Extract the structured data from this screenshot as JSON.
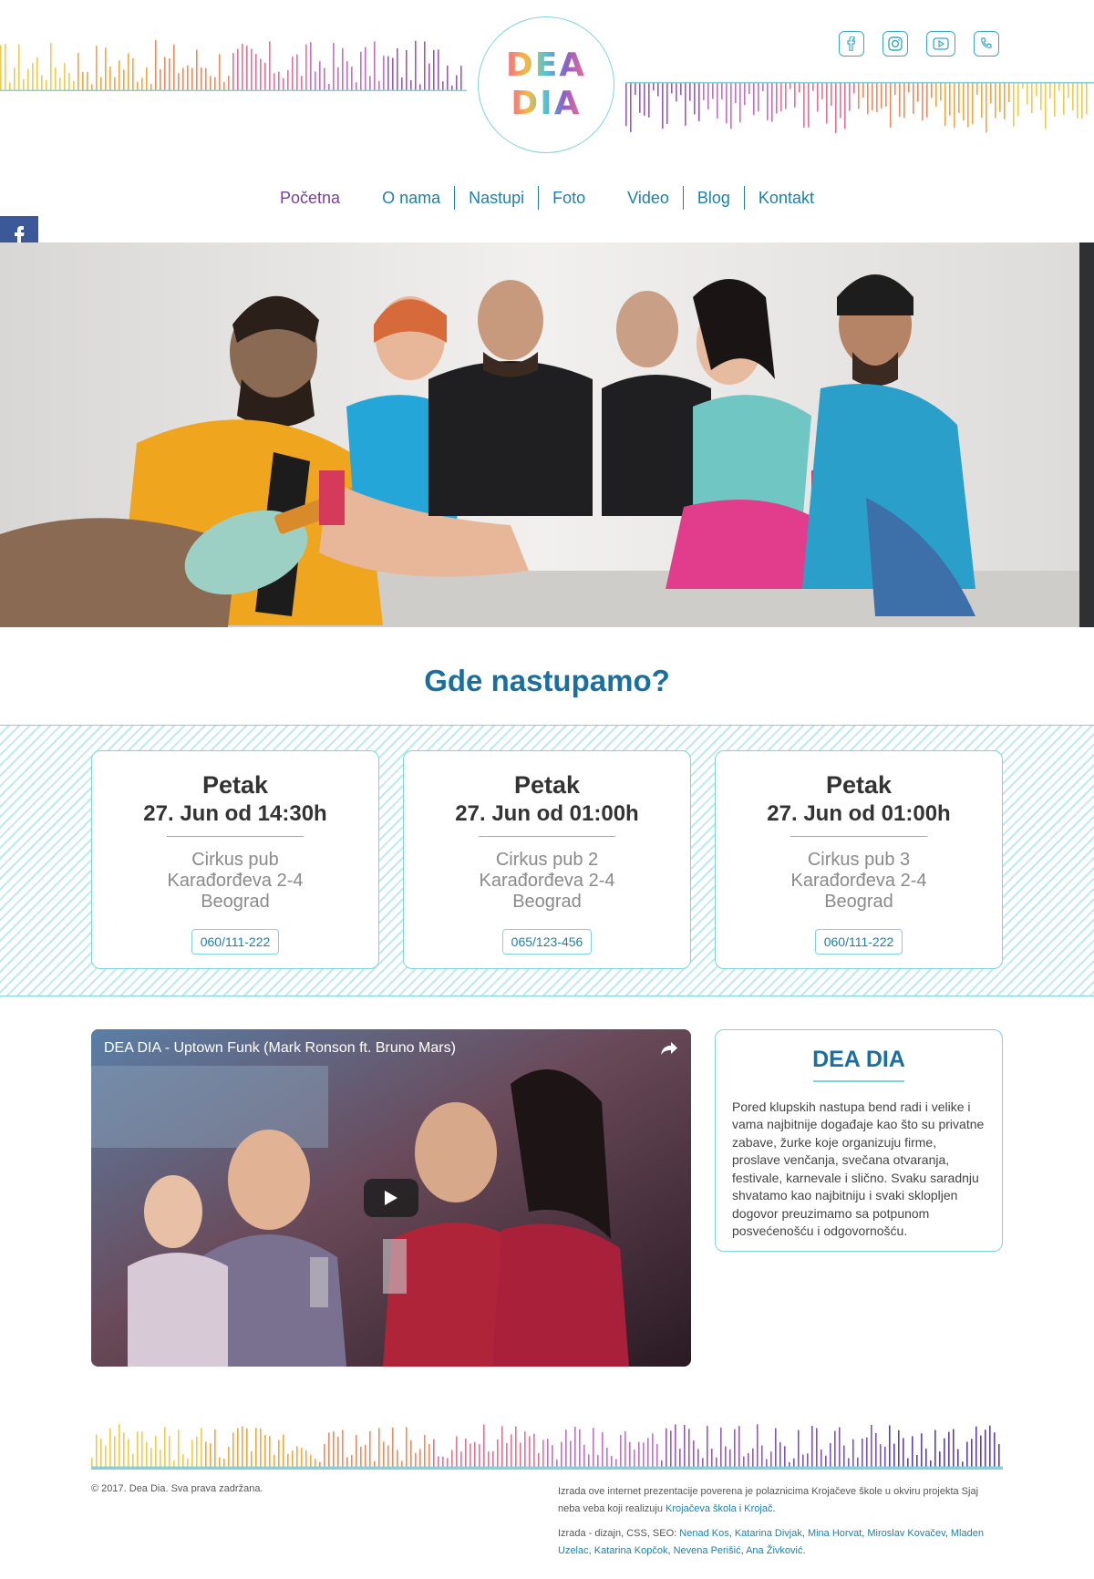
{
  "brand": {
    "logo_line1": "DEA",
    "logo_line2": "DIA"
  },
  "social_icons": [
    "facebook-icon",
    "instagram-icon",
    "youtube-icon",
    "phone-icon"
  ],
  "nav": {
    "items": [
      "Početna",
      "O nama",
      "Nastupi",
      "Foto",
      "Video",
      "Blog",
      "Kontakt"
    ]
  },
  "share_bar": [
    {
      "icon": "facebook-icon",
      "color": "#3b5998",
      "glyph": "f"
    },
    {
      "icon": "twitter-icon",
      "color": "#1da1f2",
      "glyph": "t"
    },
    {
      "icon": "whatsapp-icon",
      "color": "#2bb741",
      "glyph": "w"
    },
    {
      "icon": "viber-icon",
      "color": "#7d519a",
      "glyph": "v"
    },
    {
      "icon": "more-icon",
      "color": "#f0644f",
      "glyph": "+"
    }
  ],
  "events_section": {
    "title": "Gde nastupamo?",
    "events": [
      {
        "day": "Petak",
        "date": "27. Jun od 14:30h",
        "venue": "Cirkus pub",
        "address": "Karađorđeva 2-4",
        "city": "Beograd",
        "phone": "060/111-222"
      },
      {
        "day": "Petak",
        "date": "27. Jun od 01:00h",
        "venue": "Cirkus pub 2",
        "address": "Karađorđeva 2-4",
        "city": "Beograd",
        "phone": "065/123-456"
      },
      {
        "day": "Petak",
        "date": "27. Jun od 01:00h",
        "venue": "Cirkus pub 3",
        "address": "Karađorđeva 2-4",
        "city": "Beograd",
        "phone": "060/111-222"
      }
    ]
  },
  "video": {
    "title": "DEA DIA - Uptown Funk (Mark Ronson ft. Bruno Mars)"
  },
  "about": {
    "title": "DEA DIA",
    "text": "Pored klupskih nastupa bend radi i velike i vama najbitnije događaje kao što su privatne zabave, žurke koje organizuju firme, proslave venčanja, svečana otvaranja, festivale, karnevale i slično. Svaku saradnju shvatamo kao najbitniju i svaki sklopljen dogovor preuzimamo sa potpunom posvećenošću i odgovornošću."
  },
  "footer": {
    "copyright": "© 2017. Dea Dia. Sva prava zadržana.",
    "credits_intro": "Izrada ove internet prezentacije poverena je polaznicima Krojačeve škole u okviru projekta Sjaj neba veba koji realizuju",
    "credits_link1": "Krojačeva škola",
    "credits_and": "i",
    "credits_link2": "Krojač",
    "credits_dot": ".",
    "team_intro": "Izrada - dizajn, CSS, SEO:",
    "team": [
      "Nenad Kos",
      "Katarina Divjak",
      "Mina Horvat",
      "Miroslav Kovačev",
      "Mladen Uzelac",
      "Katarina Kopčok",
      "Nevena Perišić",
      "Ana Živković"
    ]
  }
}
